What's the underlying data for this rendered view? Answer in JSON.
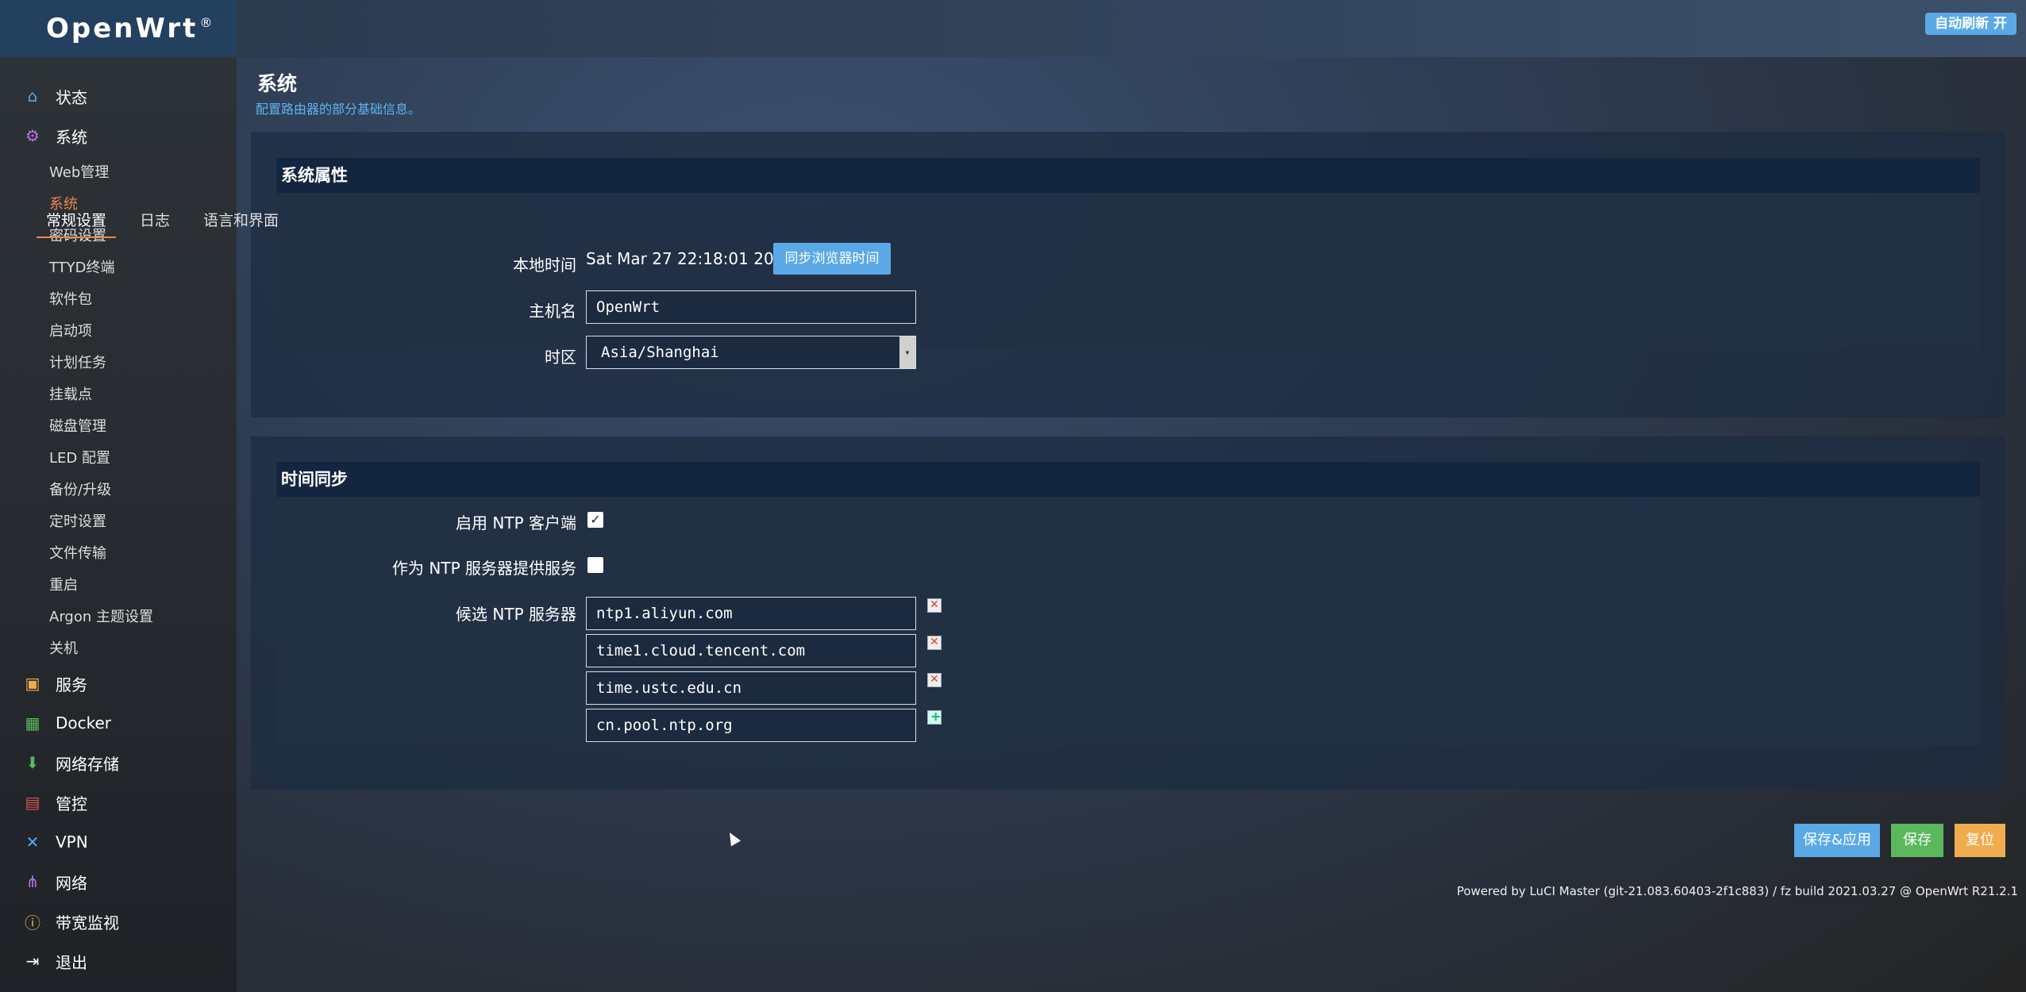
{
  "brand": {
    "name": "OpenWrt",
    "mark": "®"
  },
  "header": {
    "refresh_button": "自动刷新 开"
  },
  "sidebar": {
    "status": {
      "label": "状态",
      "icon": "home-icon"
    },
    "system": {
      "label": "系统",
      "icon": "gear-icon"
    },
    "system_items": [
      "Web管理",
      "系统",
      "密码设置",
      "TTYD终端",
      "软件包",
      "启动项",
      "计划任务",
      "挂载点",
      "磁盘管理",
      "LED 配置",
      "备份/升级",
      "定时设置",
      "文件传输",
      "重启",
      "Argon 主题设置",
      "关机"
    ],
    "active_item": "系统",
    "more": [
      {
        "label": "服务",
        "icon": "service-icon"
      },
      {
        "label": "Docker",
        "icon": "docker-icon"
      },
      {
        "label": "网络存储",
        "icon": "storage-icon"
      },
      {
        "label": "管控",
        "icon": "calendar-icon"
      },
      {
        "label": "VPN",
        "icon": "vpn-icon"
      },
      {
        "label": "网络",
        "icon": "network-icon"
      },
      {
        "label": "带宽监视",
        "icon": "bandwidth-icon"
      },
      {
        "label": "退出",
        "icon": "logout-icon"
      }
    ]
  },
  "page": {
    "title": "系统",
    "description": "配置路由器的部分基础信息。"
  },
  "system_props": {
    "title": "系统属性",
    "tabs": [
      "常规设置",
      "日志",
      "语言和界面"
    ],
    "active_tab": "常规设置",
    "local_time_label": "本地时间",
    "local_time_value": "Sat Mar 27 22:18:01 2021",
    "sync_button": "同步浏览器时间",
    "hostname_label": "主机名",
    "hostname_value": "OpenWrt",
    "timezone_label": "时区",
    "timezone_value": "Asia/Shanghai"
  },
  "time_sync": {
    "title": "时间同步",
    "ntp_client_label": "启用 NTP 客户端",
    "ntp_client_checked": true,
    "ntp_server_label": "作为 NTP 服务器提供服务",
    "ntp_server_checked": false,
    "candidate_label": "候选 NTP 服务器",
    "servers": [
      "ntp1.aliyun.com",
      "time1.cloud.tencent.com",
      "time.ustc.edu.cn",
      "cn.pool.ntp.org"
    ]
  },
  "actions": {
    "save_apply": "保存&应用",
    "save": "保存",
    "reset": "复位"
  },
  "footer": {
    "powered": "Powered by LuCI Master (git-21.083.60403-2f1c883) / fz build 2021.03.27 @ OpenWrt R21.2.1"
  },
  "colors": {
    "accent": "#f0844b",
    "primary": "#5aa9e6",
    "save": "#5cb85c",
    "reset": "#f0ad4e"
  }
}
